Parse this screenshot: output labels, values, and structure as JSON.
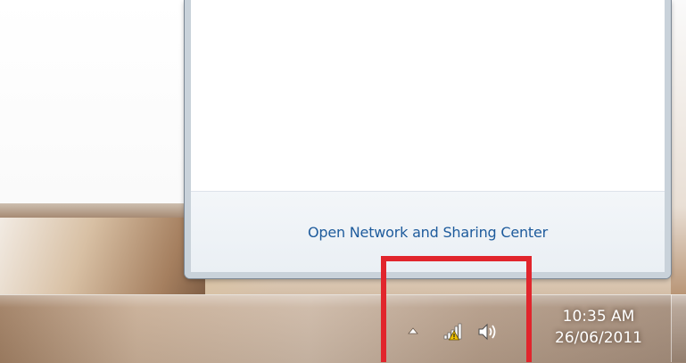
{
  "flyout": {
    "footer_link": "Open Network and Sharing Center"
  },
  "tray": {
    "icons": [
      "show-hidden-icons-arrow",
      "network-warning-icon",
      "volume-icon"
    ]
  },
  "clock": {
    "time": "10:35 AM",
    "date": "26/06/2011"
  },
  "colors": {
    "link": "#1e5b9c",
    "highlight": "#e1252c",
    "warning": "#f2c200"
  }
}
